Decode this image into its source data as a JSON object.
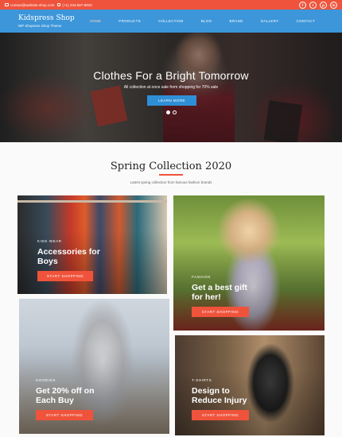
{
  "topbar": {
    "email": "contact@website-shop.com",
    "phone": "(+1) 234-567-8910",
    "socials": [
      {
        "icon": "facebook-icon",
        "glyph": "f"
      },
      {
        "icon": "twitter-icon",
        "glyph": "t"
      },
      {
        "icon": "pinterest-icon",
        "glyph": "p"
      },
      {
        "icon": "instagram-icon",
        "glyph": "in"
      }
    ]
  },
  "nav": {
    "brand": "Kidspress Shop",
    "tagline": "WP Shopress Shop Theme",
    "menu": [
      "Home",
      "Products",
      "Collection",
      "Blog",
      "Brand",
      "Gallery",
      "Contact"
    ]
  },
  "hero": {
    "title": "Clothes For a Bright Tomorrow",
    "subtitle": "All collection at once sale from shopping for 70% sale",
    "button": "Learn More"
  },
  "section": {
    "title": "Spring Collection 2020",
    "subtitle": "Latest spring collection from famous fashion brands"
  },
  "cards": [
    {
      "category": "Kids Wear",
      "title_l1": "Accessories for",
      "title_l2": "Boys",
      "button": "Start Shopping"
    },
    {
      "category": "Fashion",
      "title_l1": "Get a best gift",
      "title_l2": "for her!",
      "button": "Start Shopping"
    },
    {
      "category": "Hoodies",
      "title_l1": "Get 20% off on",
      "title_l2": "Each Buy",
      "button": "Start Shopping"
    },
    {
      "category": "T-Shirts",
      "title_l1": "Design to",
      "title_l2": "Reduce Injury",
      "button": "Start Shopping"
    }
  ],
  "colors": {
    "accent": "#f0533b",
    "nav": "#3c96d9"
  }
}
